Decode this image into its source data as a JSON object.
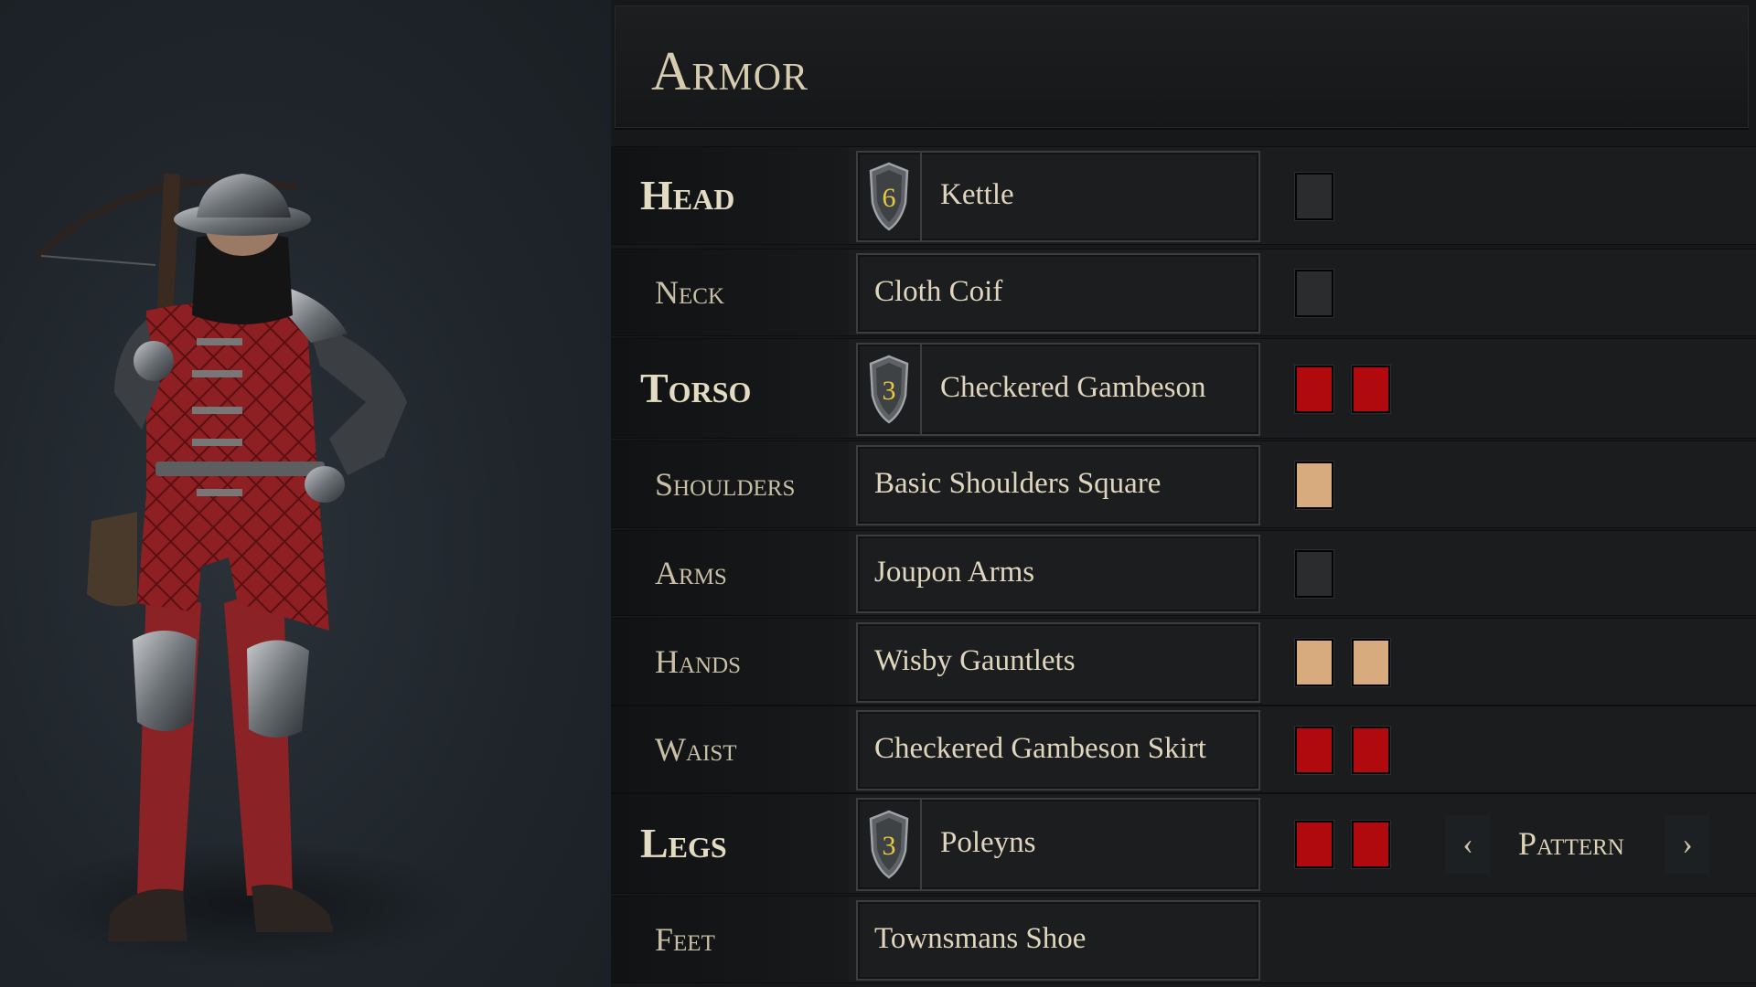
{
  "panel": {
    "title": "Armor"
  },
  "rows": [
    {
      "label": "Head",
      "major": true,
      "item": "Kettle",
      "tier": "6",
      "colors": [
        "#2a2c2e"
      ]
    },
    {
      "label": "Neck",
      "major": false,
      "item": "Cloth Coif",
      "tier": null,
      "colors": [
        "#2a2c2e"
      ]
    },
    {
      "label": "Torso",
      "major": true,
      "item": "Checkered Gambeson",
      "tier": "3",
      "colors": [
        "#b00a0e",
        "#b00a0e"
      ]
    },
    {
      "label": "Shoulders",
      "major": false,
      "item": "Basic Shoulders Square",
      "tier": null,
      "colors": [
        "#d8ab7e"
      ]
    },
    {
      "label": "Arms",
      "major": false,
      "item": "Joupon Arms",
      "tier": null,
      "colors": [
        "#2a2c2e"
      ]
    },
    {
      "label": "Hands",
      "major": false,
      "item": "Wisby Gauntlets",
      "tier": null,
      "colors": [
        "#d8ab7e",
        "#d8ab7e"
      ]
    },
    {
      "label": "Waist",
      "major": false,
      "item": "Checkered Gambeson Skirt",
      "tier": null,
      "colors": [
        "#b00a0e",
        "#b00a0e"
      ]
    },
    {
      "label": "Legs",
      "major": true,
      "item": "Poleyns",
      "tier": "3",
      "colors": [
        "#b00a0e",
        "#b00a0e"
      ]
    },
    {
      "label": "Feet",
      "major": false,
      "item": "Townsmans Shoe",
      "tier": null,
      "colors": []
    }
  ],
  "pattern": {
    "label": "Pattern",
    "prev_icon": "chevron-left-icon",
    "next_icon": "chevron-right-icon"
  },
  "theme": {
    "accent_text": "#e0d6bd",
    "tier_number": "#e8c840",
    "red": "#b00a0e",
    "tan": "#d8ab7e",
    "empty": "#2a2c2e"
  }
}
